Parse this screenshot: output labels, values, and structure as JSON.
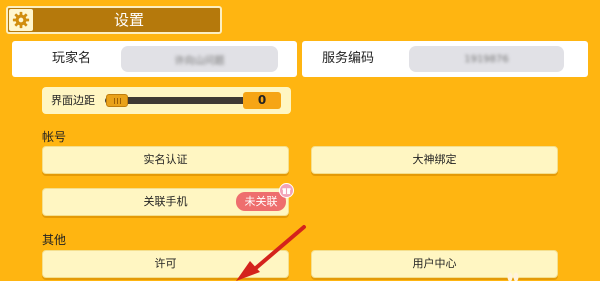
{
  "header": {
    "title": "设置",
    "icon": "gear-icon"
  },
  "player": {
    "label": "玩家名",
    "value": "许向山问题"
  },
  "service": {
    "label": "服务编码",
    "value": "1919876"
  },
  "margin_setting": {
    "label": "界面边距",
    "value": "0",
    "level": 0
  },
  "account": {
    "section_label": "帐号",
    "realname_button": "实名认证",
    "dashen_button": "大神绑定",
    "phone_button": "关联手机",
    "phone_status_badge": "未关联"
  },
  "other": {
    "section_label": "其他",
    "license_button": "许可",
    "user_center_button": "用户中心"
  },
  "colors": {
    "background": "#FFB511",
    "title_bar": "#B5790C",
    "button": "#FFF6C2",
    "badge": "#EE6E6E",
    "arrow": "#D4231C"
  }
}
